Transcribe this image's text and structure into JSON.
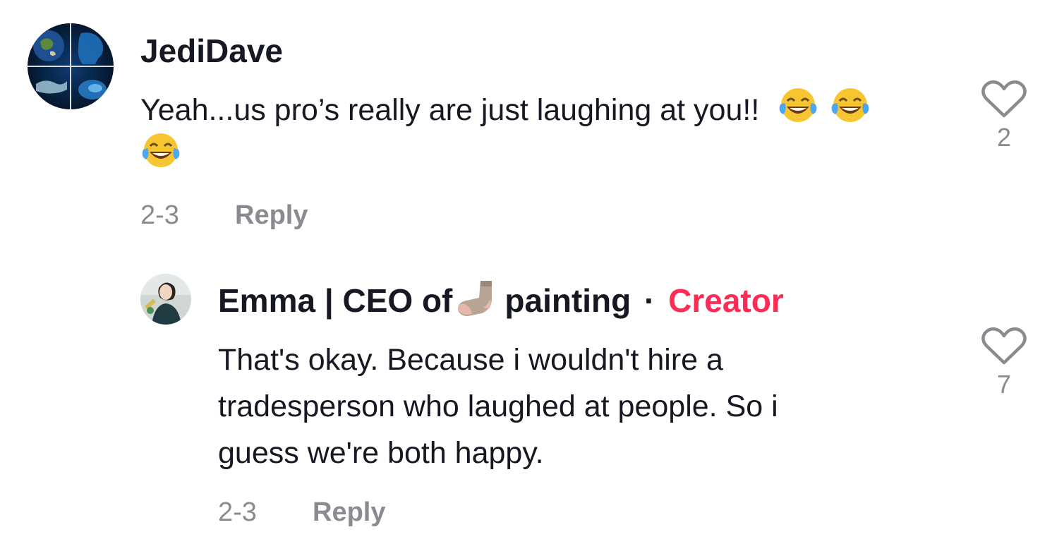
{
  "comments": [
    {
      "username": "JediDave",
      "text_line1": "Yeah...us pro’s really are just laughing at you!!",
      "emojis_line1": [
        "face-with-tears-of-joy",
        "face-with-tears-of-joy"
      ],
      "emojis_line2": [
        "face-with-tears-of-joy"
      ],
      "date": "2-3",
      "reply_label": "Reply",
      "like_count": "2"
    },
    {
      "username_part1": "Emma | CEO of",
      "username_emoji": "sock",
      "username_part2": "painting",
      "separator": "·",
      "badge": "Creator",
      "text_lines": [
        "That's okay. Because i wouldn't hire a",
        "tradesperson who laughed at people. So i",
        "guess we're both happy."
      ],
      "date": "2-3",
      "reply_label": "Reply",
      "like_count": "7"
    }
  ],
  "colors": {
    "primary_text": "#161823",
    "secondary_text": "#8a8b91",
    "creator_badge": "#fe2c55"
  },
  "icons": [
    "heart-outline-icon",
    "face-with-tears-of-joy-emoji",
    "sock-emoji"
  ]
}
